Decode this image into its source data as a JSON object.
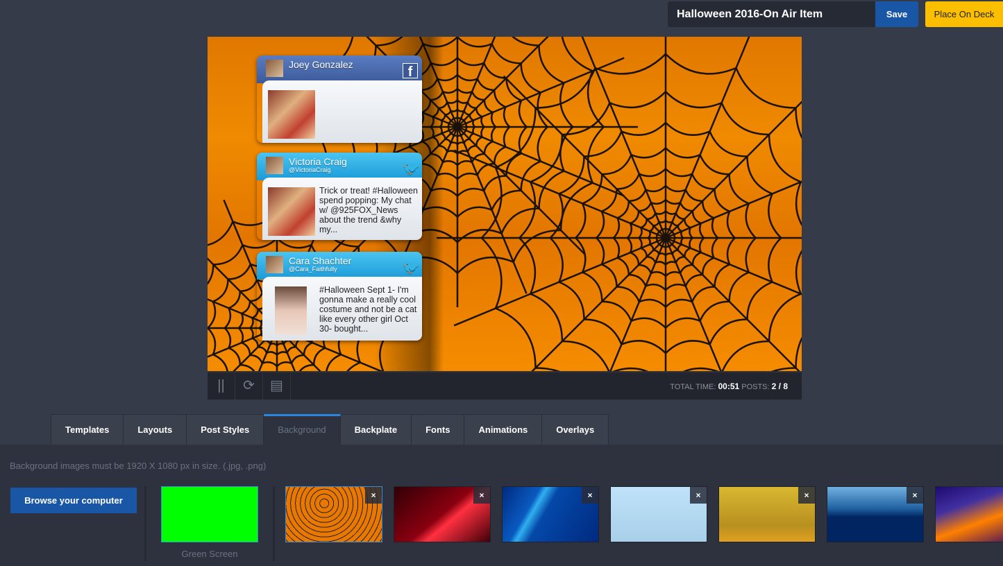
{
  "header": {
    "item_title": "Halloween 2016-On Air Item",
    "save_label": "Save",
    "deck_label": "Place On Deck"
  },
  "posts": [
    {
      "network": "facebook",
      "name": "Joey Gonzalez",
      "handle": "",
      "text": "",
      "brand_icon": "f"
    },
    {
      "network": "twitter",
      "name": "Victoria Craig",
      "handle": "@VictoriaCraig",
      "text": "Trick or treat! #Halloween spend popping: My chat w/ @925FOX_News about the trend &why my...",
      "brand_icon": "twitter-bird"
    },
    {
      "network": "twitter",
      "name": "Cara Shachter",
      "handle": "@Cara_Faithfully",
      "text": "#Halloween Sept 1- I'm gonna make a really cool costume and not be a cat like every other girl Oct 30- bought...",
      "brand_icon": "twitter-bird"
    }
  ],
  "controls": {
    "total_time_label": "TOTAL TIME:",
    "total_time": "00:51",
    "posts_label": "POSTS:",
    "posts": "2 / 8"
  },
  "tabs": [
    {
      "label": "Templates"
    },
    {
      "label": "Layouts"
    },
    {
      "label": "Post Styles"
    },
    {
      "label": "Background",
      "active": true
    },
    {
      "label": "Backplate"
    },
    {
      "label": "Fonts"
    },
    {
      "label": "Animations"
    },
    {
      "label": "Overlays"
    }
  ],
  "background": {
    "hint": "Background images must be 1920 X 1080 px in size. (.jpg, .png)",
    "browse_label": "Browse your computer",
    "green_screen_label": "Green Screen",
    "remove_icon": "×",
    "thumbnails": [
      "halloween-webs",
      "red-light",
      "blue-waves",
      "flag",
      "fall-back",
      "city-skyline",
      "orange-purple"
    ]
  }
}
